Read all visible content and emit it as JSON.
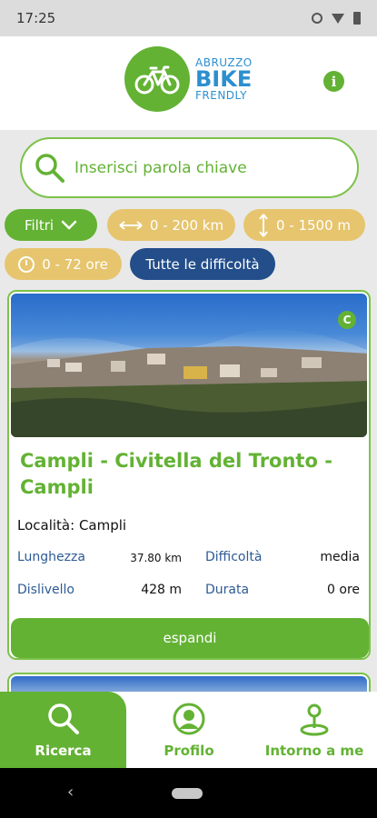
{
  "status_bar": {
    "time": "17:25"
  },
  "header": {
    "logo": {
      "line1": "ABRUZZO",
      "line2": "BIKE",
      "line3": "FRENDLY",
      "icon": "bicycle-icon"
    },
    "info_icon": "info-icon",
    "info_glyph": "i"
  },
  "search": {
    "placeholder": "Inserisci parola chiave",
    "icon": "search-icon"
  },
  "filters": {
    "filter_label": "Filtri",
    "distance": "0 - 200 km",
    "elevation": "0 - 1500 m",
    "duration": "0 - 72 ore",
    "difficulty": "Tutte le difficoltà"
  },
  "route_card": {
    "badge": "C",
    "title": "Campli - Civitella del Tronto - Campli",
    "location": "Località: Campli",
    "length_label": "Lunghezza",
    "length_value": "37.80 km",
    "difficulty_label": "Difficoltà",
    "difficulty_value": "media",
    "elevation_label": "Dislivello",
    "elevation_value": "428 m",
    "duration_label": "Durata",
    "duration_value": "0 ore",
    "expand_label": "espandi"
  },
  "bottom_nav": {
    "items": [
      {
        "label": "Ricerca",
        "icon": "search-icon",
        "active": true
      },
      {
        "label": "Profilo",
        "icon": "user-icon",
        "active": false
      },
      {
        "label": "Intorno a me",
        "icon": "map-pin-icon",
        "active": false
      }
    ]
  },
  "system_nav": {
    "back_glyph": "‹"
  },
  "colors": {
    "green": "#63b234",
    "blue": "#2c8fcf",
    "navy": "#234e8a",
    "gold": "#e6c56e"
  }
}
